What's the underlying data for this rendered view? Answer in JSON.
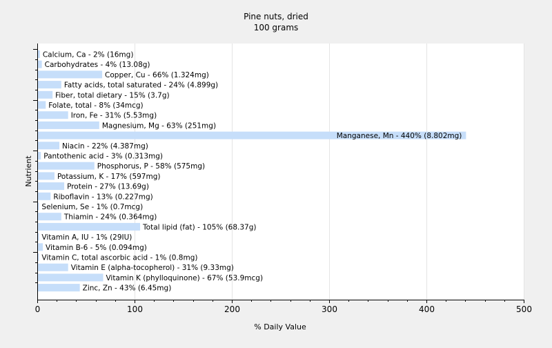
{
  "chart_data": {
    "type": "bar",
    "orientation": "horizontal",
    "title": "Pine nuts, dried",
    "subtitle": "100 grams",
    "xlabel": "% Daily Value",
    "ylabel": "Nutrient",
    "xlim": [
      0,
      500
    ],
    "xticks": [
      "0",
      "100",
      "200",
      "300",
      "400",
      "500"
    ],
    "grid": true,
    "bar_color": "#c6defa",
    "categories": [
      "Calcium, Ca",
      "Carbohydrates",
      "Copper, Cu",
      "Fatty acids, total saturated",
      "Fiber, total dietary",
      "Folate, total",
      "Iron, Fe",
      "Magnesium, Mg",
      "Manganese, Mn",
      "Niacin",
      "Pantothenic acid",
      "Phosphorus, P",
      "Potassium, K",
      "Protein",
      "Riboflavin",
      "Selenium, Se",
      "Thiamin",
      "Total lipid (fat)",
      "Vitamin A, IU",
      "Vitamin B-6",
      "Vitamin C, total ascorbic acid",
      "Vitamin E (alpha-tocopherol)",
      "Vitamin K (phylloquinone)",
      "Zinc, Zn"
    ],
    "values": [
      2,
      4,
      66,
      24,
      15,
      8,
      31,
      63,
      440,
      22,
      3,
      58,
      17,
      27,
      13,
      1,
      24,
      105,
      1,
      5,
      1,
      31,
      67,
      43
    ],
    "labels": [
      "Calcium, Ca - 2% (16mg)",
      "Carbohydrates - 4% (13.08g)",
      "Copper, Cu - 66% (1.324mg)",
      "Fatty acids, total saturated - 24% (4.899g)",
      "Fiber, total dietary - 15% (3.7g)",
      "Folate, total - 8% (34mcg)",
      "Iron, Fe - 31% (5.53mg)",
      "Magnesium, Mg - 63% (251mg)",
      "Manganese, Mn - 440% (8.802mg)",
      "Niacin - 22% (4.387mg)",
      "Pantothenic acid - 3% (0.313mg)",
      "Phosphorus, P - 58% (575mg)",
      "Potassium, K - 17% (597mg)",
      "Protein - 27% (13.69g)",
      "Riboflavin - 13% (0.227mg)",
      "Selenium, Se - 1% (0.7mcg)",
      "Thiamin - 24% (0.364mg)",
      "Total lipid (fat) - 105% (68.37g)",
      "Vitamin A, IU - 1% (29IU)",
      "Vitamin B-6 - 5% (0.094mg)",
      "Vitamin C, total ascorbic acid - 1% (0.8mg)",
      "Vitamin E (alpha-tocopherol) - 31% (9.33mg)",
      "Vitamin K (phylloquinone) - 67% (53.9mcg)",
      "Zinc, Zn - 43% (6.45mg)"
    ]
  }
}
